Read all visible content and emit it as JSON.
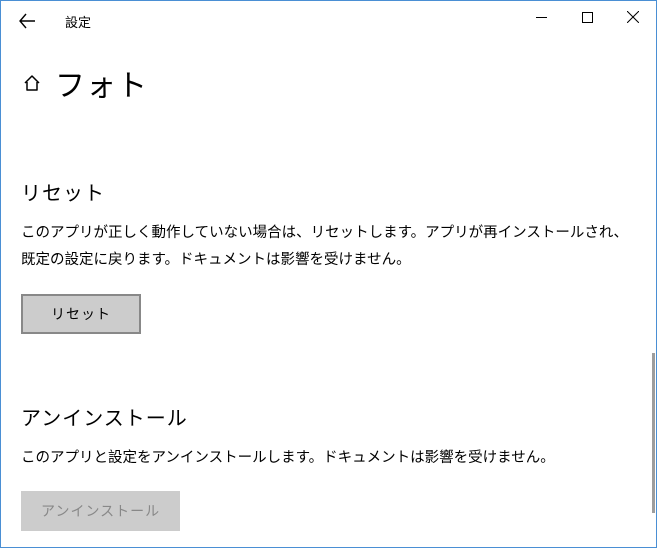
{
  "window": {
    "title": "設定"
  },
  "page": {
    "title": "フォト"
  },
  "sections": {
    "reset": {
      "title": "リセット",
      "description": "このアプリが正しく動作していない場合は、リセットします。アプリが再インストールされ、既定の設定に戻ります。ドキュメントは影響を受けません。",
      "button": "リセット"
    },
    "uninstall": {
      "title": "アンインストール",
      "description": "このアプリと設定をアンインストールします。ドキュメントは影響を受けません。",
      "button": "アンインストール"
    }
  }
}
